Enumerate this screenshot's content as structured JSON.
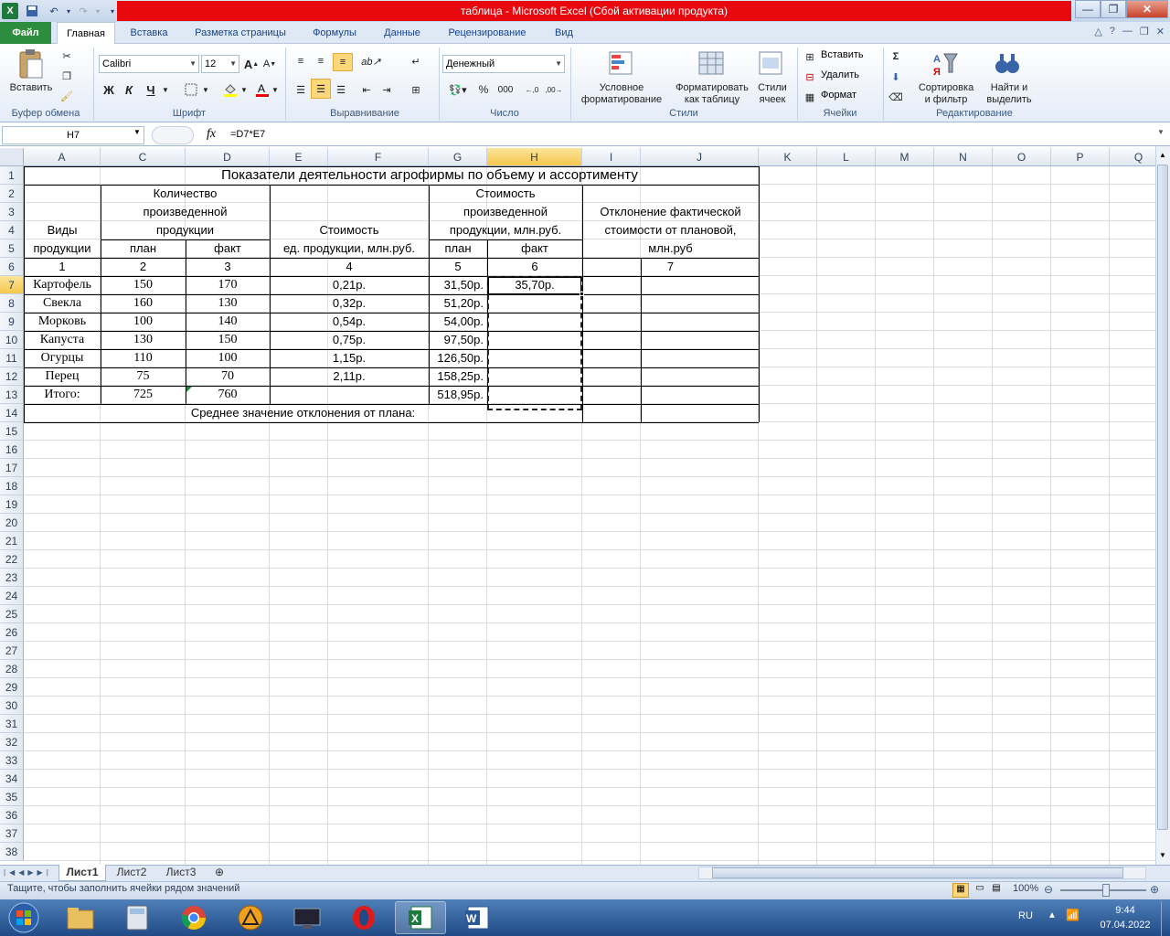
{
  "window": {
    "title": "таблица - Microsoft Excel (Сбой активации продукта)"
  },
  "tabs": [
    "Файл",
    "Главная",
    "Вставка",
    "Разметка страницы",
    "Формулы",
    "Данные",
    "Рецензирование",
    "Вид"
  ],
  "ribbon": {
    "paste_label": "Вставить",
    "font_name": "Calibri",
    "font_size": "12",
    "bold": "Ж",
    "italic": "К",
    "underline": "Ч",
    "number_format": "Денежный",
    "percent": "%",
    "thousands": "000",
    "cond_format": [
      "Условное",
      "форматирование"
    ],
    "format_table": [
      "Форматировать",
      "как таблицу"
    ],
    "cell_styles": [
      "Стили",
      "ячеек"
    ],
    "insert": "Вставить",
    "delete": "Удалить",
    "format": "Формат",
    "sort_filter": [
      "Сортировка",
      "и фильтр"
    ],
    "find_select": [
      "Найти и",
      "выделить"
    ],
    "groups": [
      "Буфер обмена",
      "Шрифт",
      "Выравнивание",
      "Число",
      "Стили",
      "Ячейки",
      "Редактирование"
    ]
  },
  "formula_bar": {
    "name_box": "H7",
    "fx": "fx",
    "formula": "=D7*E7"
  },
  "columns": [
    "A",
    "C",
    "D",
    "E",
    "F",
    "G",
    "H",
    "I",
    "J",
    "K",
    "L",
    "M",
    "N",
    "O",
    "P",
    "Q"
  ],
  "rows": [
    "1",
    "2",
    "3",
    "4",
    "5",
    "6",
    "7",
    "8",
    "9",
    "10",
    "11",
    "12",
    "13",
    "14",
    "15",
    "16",
    "17",
    "18",
    "19",
    "20",
    "21",
    "22",
    "23",
    "24",
    "25",
    "26",
    "27",
    "28",
    "29",
    "30",
    "31",
    "32",
    "33",
    "34",
    "35",
    "36",
    "37",
    "38"
  ],
  "sheet": {
    "title": "Показатели деятельности агрофирмы по объему и ассортименту",
    "hdr_kind": [
      "Виды",
      "продукции"
    ],
    "hdr_qty": [
      "Количество",
      "произведенной",
      "продукции"
    ],
    "hdr_unit_cost": [
      "Стоимость",
      "ед. продукции, млн.руб."
    ],
    "hdr_cost": [
      "Стоимость",
      "произведенной",
      "продукции, млн.руб."
    ],
    "hdr_dev": [
      "Отклонение фактической",
      "стоимости от плановой,",
      "млн.руб"
    ],
    "plan": "план",
    "fact": "факт",
    "nums": [
      "1",
      "2",
      "3",
      "4",
      "5",
      "6",
      "7"
    ],
    "data": [
      {
        "name": "Картофель",
        "plan": "150",
        "fact": "170",
        "unit": "0,21р.",
        "cost_plan": "31,50р.",
        "cost_fact": "35,70р."
      },
      {
        "name": "Свекла",
        "plan": "160",
        "fact": "130",
        "unit": "0,32р.",
        "cost_plan": "51,20р.",
        "cost_fact": ""
      },
      {
        "name": "Морковь",
        "plan": "100",
        "fact": "140",
        "unit": "0,54р.",
        "cost_plan": "54,00р.",
        "cost_fact": ""
      },
      {
        "name": "Капуста",
        "plan": "130",
        "fact": "150",
        "unit": "0,75р.",
        "cost_plan": "97,50р.",
        "cost_fact": ""
      },
      {
        "name": "Огурцы",
        "plan": "110",
        "fact": "100",
        "unit": "1,15р.",
        "cost_plan": "126,50р.",
        "cost_fact": ""
      },
      {
        "name": "Перец",
        "plan": "75",
        "fact": "70",
        "unit": "2,11р.",
        "cost_plan": "158,25р.",
        "cost_fact": ""
      }
    ],
    "total": {
      "name": "Итого:",
      "plan": "725",
      "fact": "760",
      "cost_plan": "518,95р."
    },
    "avg_label": "Среднее значение отклонения от плана:"
  },
  "sheet_tabs": [
    "Лист1",
    "Лист2",
    "Лист3"
  ],
  "status": {
    "message": "Тащите, чтобы заполнить ячейки рядом значений",
    "zoom": "100%"
  },
  "taskbar": {
    "lang": "RU",
    "time": "9:44",
    "date": "07.04.2022"
  }
}
